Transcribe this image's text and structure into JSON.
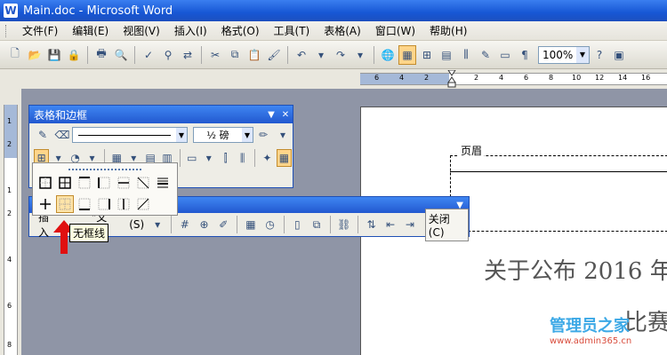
{
  "window": {
    "title": "Main.doc - Microsoft Word",
    "app_icon": "W"
  },
  "menu": [
    "文件(F)",
    "编辑(E)",
    "视图(V)",
    "插入(I)",
    "格式(O)",
    "工具(T)",
    "表格(A)",
    "窗口(W)",
    "帮助(H)"
  ],
  "toolbar": {
    "zoom": "100%"
  },
  "ruler": {
    "ticks": [
      "6",
      "4",
      "2",
      "2",
      "4",
      "6",
      "8",
      "10",
      "12",
      "14",
      "16",
      "18"
    ],
    "vticks": [
      "1",
      "2",
      "1",
      "2",
      "4",
      "6",
      "8"
    ]
  },
  "tables_borders": {
    "title": "表格和边框",
    "weight": "½ 磅"
  },
  "palette": {
    "tooltip": "无框线"
  },
  "header_footer": {
    "insert_label": "插入",
    "autotext": "\"文集\"",
    "shortcut": "(S)",
    "close": "关闭(C)"
  },
  "document": {
    "header_label": "页眉",
    "title": "关于公布 2016 年",
    "subtitle": "比赛"
  },
  "watermark": {
    "main": "管理员之家",
    "url": "www.admin365.cn"
  },
  "colors": {
    "titlebar": "#1757d4",
    "accent": "#ffd58a",
    "arrow": "#e01010"
  }
}
